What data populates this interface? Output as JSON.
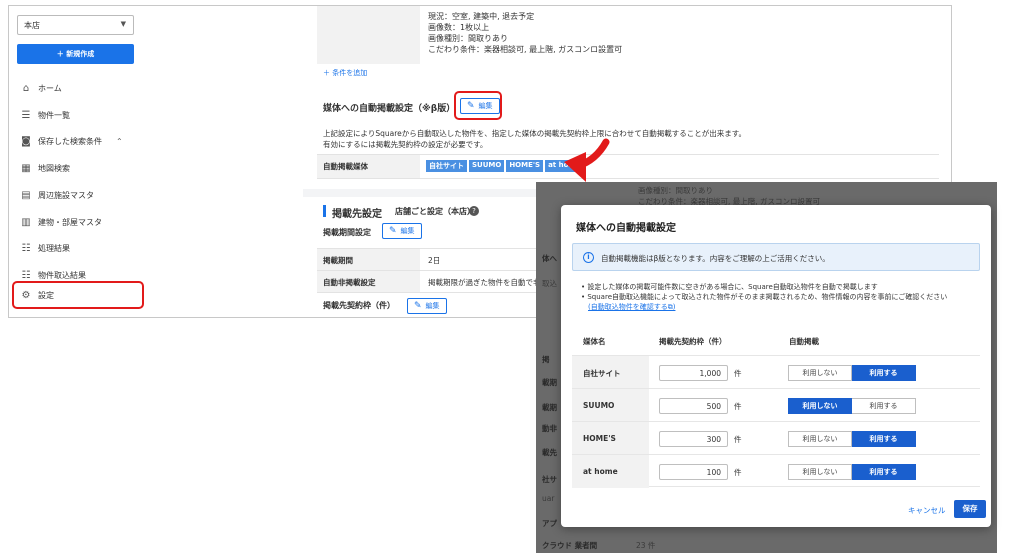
{
  "sidebar": {
    "store_select": "本店",
    "new_button": "＋ 新規作成",
    "items": [
      {
        "icon": "⌂",
        "label": "ホーム"
      },
      {
        "icon": "☰",
        "label": "物件一覧"
      },
      {
        "icon": "◙",
        "label": "保存した検索条件"
      },
      {
        "icon": "▦",
        "label": "地図検索"
      },
      {
        "icon": "▤",
        "label": "周辺施設マスタ"
      },
      {
        "icon": "▥",
        "label": "建物・部屋マスタ"
      },
      {
        "icon": "☷",
        "label": "処理結果"
      },
      {
        "icon": "☷",
        "label": "物件取込結果"
      },
      {
        "icon": "⚙",
        "label": "設定"
      }
    ]
  },
  "conditions": {
    "lines": [
      "現況：空室, 建築中, 退去予定",
      "画像数：1枚以上",
      "画像種別：間取りあり",
      "こだわり条件：楽器相談可, 最上階, ガスコンロ設置可"
    ],
    "add_link": "＋ 条件を追加"
  },
  "auto_post": {
    "title": "媒体への自動掲載設定（※β版）",
    "edit_label": "編集",
    "desc1": "上記設定によりSquareから自動取込した物件を、指定した媒体の掲載先契約枠上限に合わせて自動掲載することが出来ます。",
    "desc2": "有効にするには掲載先契約枠の設定が必要です。",
    "media_label": "自動掲載媒体",
    "media_tags": [
      "自社サイト",
      "SUUMO",
      "HOME'S",
      "at home"
    ]
  },
  "listing": {
    "title": "掲載先設定",
    "sub": "店舗ごと設定（本店）",
    "period_title": "掲載期間設定",
    "edit_label": "編集",
    "period_label": "掲載期間",
    "period_value": "2日",
    "auto_off_label": "自動非掲載設定",
    "auto_off_value": "掲載期限が過ぎた物件を自動で非掲",
    "quota_title": "掲載先契約枠（件）"
  },
  "modal_backdrop": {
    "texts": [
      "画像種別：間取りあり",
      "こだわり条件：楽器相談可, 最上階, ガスコンロ設置可",
      "体へ",
      "取込",
      "掲",
      "載期",
      "載期",
      "動非",
      "載先",
      "社サ",
      "uar",
      "アプ",
      "クラウド 業者間",
      "23 件"
    ]
  },
  "modal": {
    "title": "媒体への自動掲載設定",
    "notice": "自動掲載機能はβ版となります。内容をご理解の上ご活用ください。",
    "bullet1": "設定した媒体の掲載可能件数に空きがある場合に、Square自動取込物件を自動で掲載します",
    "bullet2": "Square自動取込機能によって取込された物件がそのまま掲載されるため、物件情報の内容を事前にご確認ください",
    "bullet_link": "(自動取込物件を確認する⧉)",
    "col_media": "媒体名",
    "col_quota": "掲載先契約枠（件）",
    "col_auto": "自動掲載",
    "unit": "件",
    "off_label": "利用しない",
    "on_label": "利用する",
    "rows": [
      {
        "name": "自社サイト",
        "quota": "1,000",
        "enabled": true
      },
      {
        "name": "SUUMO",
        "quota": "500",
        "enabled": false
      },
      {
        "name": "HOME'S",
        "quota": "300",
        "enabled": true
      },
      {
        "name": "at home",
        "quota": "100",
        "enabled": true
      }
    ],
    "cancel": "キャンセル",
    "save": "保存"
  },
  "colors": {
    "accent": "#1a73e8",
    "highlight": "#e21a1a",
    "toggle_on": "#1a5fce"
  }
}
